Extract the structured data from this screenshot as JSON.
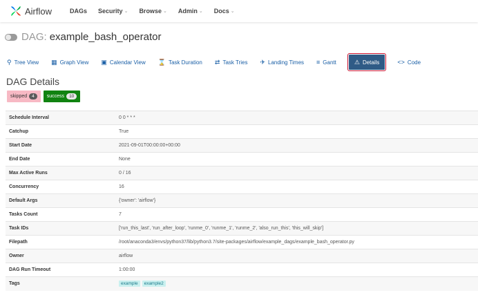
{
  "navbar": {
    "brand": "Airflow",
    "items": [
      {
        "label": "DAGs",
        "dropdown": false
      },
      {
        "label": "Security",
        "dropdown": true
      },
      {
        "label": "Browse",
        "dropdown": true
      },
      {
        "label": "Admin",
        "dropdown": true
      },
      {
        "label": "Docs",
        "dropdown": true
      }
    ]
  },
  "dag": {
    "prefix": "DAG:",
    "name": "example_bash_operator",
    "paused_toggle": "off"
  },
  "tabs": [
    {
      "label": "Tree View",
      "icon": "tree-icon",
      "active": false
    },
    {
      "label": "Graph View",
      "icon": "graph-icon",
      "active": false
    },
    {
      "label": "Calendar View",
      "icon": "calendar-icon",
      "active": false
    },
    {
      "label": "Task Duration",
      "icon": "hourglass-icon",
      "active": false
    },
    {
      "label": "Task Tries",
      "icon": "retry-icon",
      "active": false
    },
    {
      "label": "Landing Times",
      "icon": "landing-icon",
      "active": false
    },
    {
      "label": "Gantt",
      "icon": "gantt-icon",
      "active": false
    },
    {
      "label": "Details",
      "icon": "warning-icon",
      "active": true
    },
    {
      "label": "Code",
      "icon": "code-icon",
      "active": false
    }
  ],
  "section_title": "DAG Details",
  "states": [
    {
      "label": "skipped",
      "count": "4"
    },
    {
      "label": "success",
      "count": "10"
    }
  ],
  "details": {
    "rows": [
      {
        "key": "Schedule Interval",
        "value": "0 0 * * *"
      },
      {
        "key": "Catchup",
        "value": "True"
      },
      {
        "key": "Start Date",
        "value": "2021-09-01T00:00:00+00:00"
      },
      {
        "key": "End Date",
        "value": "None"
      },
      {
        "key": "Max Active Runs",
        "value": "0 / 16"
      },
      {
        "key": "Concurrency",
        "value": "16"
      },
      {
        "key": "Default Args",
        "value": "{'owner': 'airflow'}"
      },
      {
        "key": "Tasks Count",
        "value": "7"
      },
      {
        "key": "Task IDs",
        "value": "['run_this_last', 'run_after_loop', 'runme_0', 'runme_1', 'runme_2', 'also_run_this', 'this_will_skip']"
      },
      {
        "key": "Filepath",
        "value": "/root/anaconda3/envs/python37/lib/python3.7/site-packages/airflow/example_dags/example_bash_operator.py"
      },
      {
        "key": "Owner",
        "value": "airflow"
      },
      {
        "key": "DAG Run Timeout",
        "value": "1:00:00"
      }
    ],
    "tags_label": "Tags",
    "tags": [
      "example",
      "example2"
    ]
  },
  "colors": {
    "active_tab": "#2f5b86",
    "active_tab_outline": "#c8102e",
    "skipped": "#f7b9c4",
    "success": "#118311",
    "tag": "#c9f0ef"
  }
}
